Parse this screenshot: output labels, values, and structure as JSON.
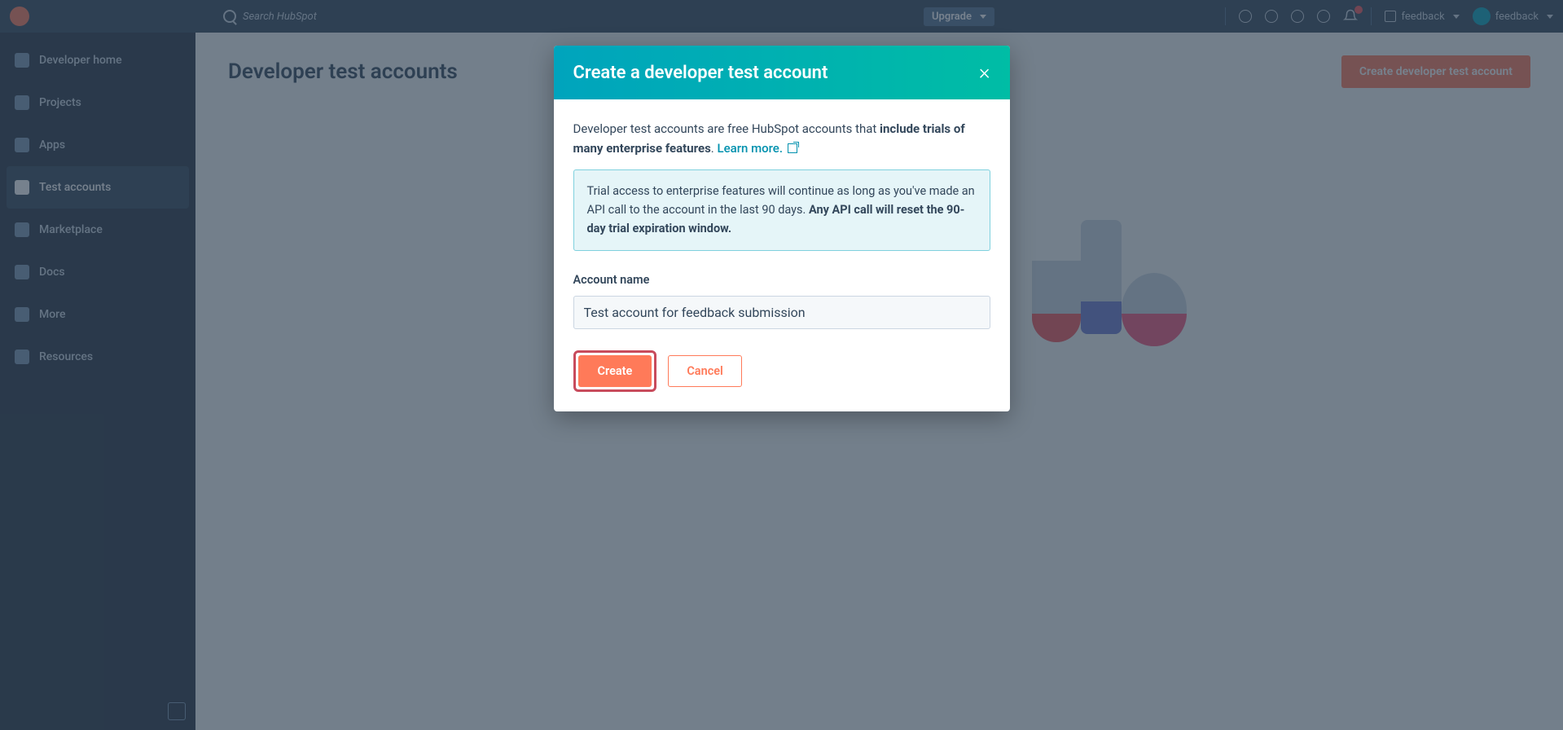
{
  "topnav": {
    "search_placeholder": "Search HubSpot",
    "upgrade": "Upgrade",
    "account_label": "feedback",
    "user_label": "feedback"
  },
  "sidebar": {
    "items": [
      {
        "label": "Developer home"
      },
      {
        "label": "Projects"
      },
      {
        "label": "Apps"
      },
      {
        "label": "Test accounts"
      },
      {
        "label": "Marketplace"
      },
      {
        "label": "Docs"
      },
      {
        "label": "More"
      },
      {
        "label": "Resources"
      }
    ]
  },
  "page": {
    "title": "Developer test accounts",
    "create_button": "Create developer test account"
  },
  "modal": {
    "title": "Create a developer test account",
    "intro_prefix": "Developer test accounts are free HubSpot accounts that ",
    "intro_bold": "include trials of many enterprise features",
    "intro_suffix": ". ",
    "learn_more": "Learn more.",
    "info_prefix": "Trial access to enterprise features will continue as long as you've made an API call to the account in the last 90 days. ",
    "info_bold": "Any API call will reset the 90-day trial expiration window.",
    "field_label": "Account name",
    "field_value": "Test account for feedback submission",
    "create": "Create",
    "cancel": "Cancel"
  }
}
